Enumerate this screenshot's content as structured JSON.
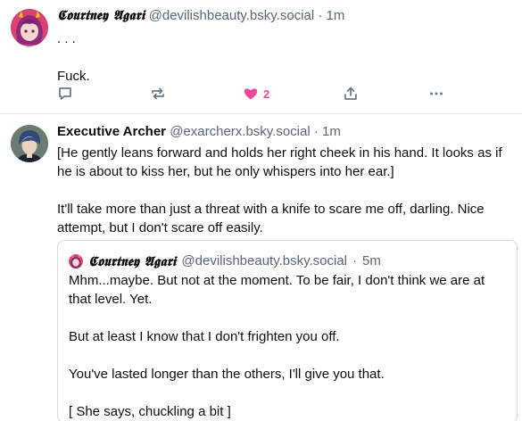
{
  "posts": [
    {
      "display_name": "𝕮𝖔𝖚𝖗𝖙𝖓𝖊𝖞 𝕬𝖌𝖆𝖗𝖎",
      "handle": "@devilishbeauty.bsky.social",
      "separator": "·",
      "time": "1m",
      "text": [
        ". . .",
        "Fuck."
      ],
      "like_count": "2",
      "like_color": "#ec4899"
    },
    {
      "display_name": "Executive Archer",
      "handle": "@exarcherx.bsky.social",
      "separator": "·",
      "time": "1m",
      "text": [
        "[He gently leans forward and holds her right cheek in his hand. It looks as if he is about to kiss her, but he only whispers into her ear.]",
        "It'll take more than just a threat with a knife to scare me off, darling. Nice attempt, but I don't scare off easily."
      ],
      "quote": {
        "display_name": "𝕮𝖔𝖚𝖗𝖙𝖓𝖊𝖞 𝕬𝖌𝖆𝖗𝖎",
        "handle": "@devilishbeauty.bsky.social",
        "separator": "·",
        "time": "5m",
        "text": [
          "Mhm...maybe. But not at the moment. To be fair, I don't think we are at that level. Yet.",
          "But at least I know that I don't frighten you off.",
          "You've lasted longer than the others, I'll give you that.",
          "[ She says, chuckling a bit ]"
        ]
      }
    }
  ],
  "icons": {
    "reply": "reply-icon",
    "repost": "repost-icon",
    "like": "heart-icon",
    "share": "share-icon",
    "more": "more-icon"
  }
}
